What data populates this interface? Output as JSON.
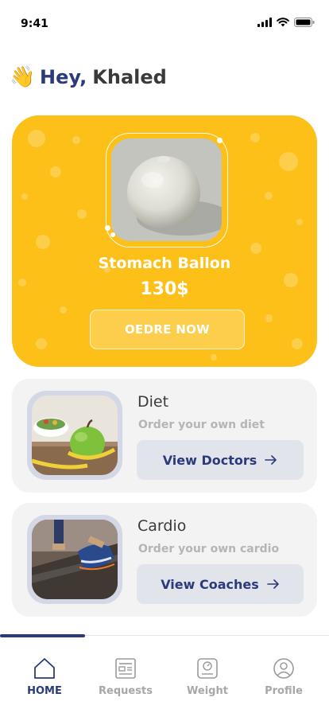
{
  "status": {
    "time": "9:41"
  },
  "greeting": {
    "wave": "👋",
    "hey": "Hey,",
    "name": "Khaled"
  },
  "hero": {
    "title": "Stomach Ballon",
    "price": "130$",
    "order_label": "OEDRE NOW"
  },
  "services": [
    {
      "title": "Diet",
      "subtitle": "Order your own diet",
      "button_label": "View Doctors"
    },
    {
      "title": "Cardio",
      "subtitle": "Order your own cardio",
      "button_label": "View Coaches"
    }
  ],
  "tabs": [
    {
      "label": "HOME",
      "icon": "home-icon",
      "active": true
    },
    {
      "label": "Requests",
      "icon": "requests-icon",
      "active": false
    },
    {
      "label": "Weight",
      "icon": "scale-icon",
      "active": false
    },
    {
      "label": "Profile",
      "icon": "profile-icon",
      "active": false
    }
  ],
  "colors": {
    "accent": "#2b3a7a",
    "hero": "#fcc019",
    "card": "#f3f3f4"
  }
}
